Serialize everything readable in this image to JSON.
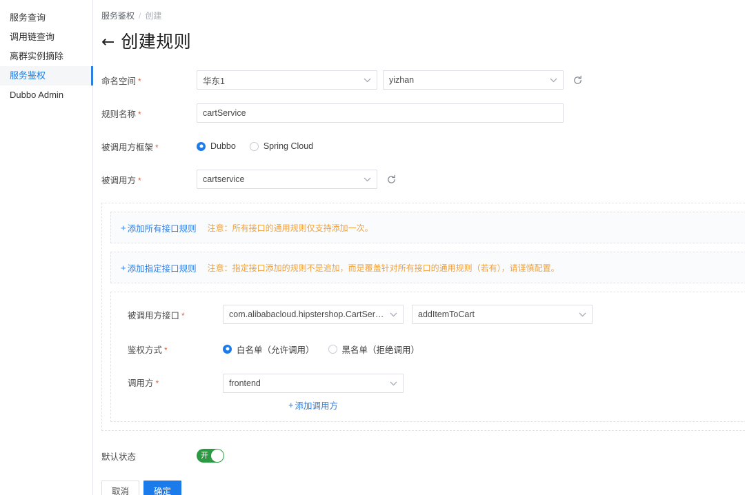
{
  "sidebar": {
    "items": [
      {
        "label": "服务查询",
        "active": false
      },
      {
        "label": "调用链查询",
        "active": false
      },
      {
        "label": "离群实例摘除",
        "active": false
      },
      {
        "label": "服务鉴权",
        "active": true
      },
      {
        "label": "Dubbo Admin",
        "active": false
      }
    ]
  },
  "breadcrumb": {
    "root": "服务鉴权",
    "separator": "/",
    "current": "创建"
  },
  "header": {
    "back_icon": "←",
    "title": "创建规则"
  },
  "form": {
    "namespace": {
      "label": "命名空间",
      "required": "*",
      "region_value": "华东1",
      "namespace_value": "yizhan",
      "refresh_icon": "refresh-icon"
    },
    "rule_name": {
      "label": "规则名称",
      "required": "*",
      "value": "cartService",
      "placeholder": ""
    },
    "framework": {
      "label": "被调用方框架",
      "required": "*",
      "options": [
        {
          "label": "Dubbo",
          "selected": true
        },
        {
          "label": "Spring Cloud",
          "selected": false
        }
      ]
    },
    "callee": {
      "label": "被调用方",
      "required": "*",
      "value": "cartservice",
      "refresh_icon": "refresh-icon"
    }
  },
  "rules": {
    "all_interface": {
      "add_label": "添加所有接口规则",
      "plus": "+",
      "note": "注意：所有接口的通用规则仅支持添加一次。"
    },
    "specified_interface": {
      "add_label": "添加指定接口规则",
      "plus": "+",
      "note": "注意：指定接口添加的规则不是追加，而是覆盖针对所有接口的通用规则（若有），请谨慎配置。"
    },
    "interface_card": {
      "close_icon": "✕",
      "interface": {
        "label": "被调用方接口",
        "required": "*",
        "class_value": "com.alibabacloud.hipstershop.CartServic...",
        "method_value": "addItemToCart"
      },
      "auth_mode": {
        "label": "鉴权方式",
        "required": "*",
        "options": [
          {
            "label": "白名单（允许调用）",
            "selected": true
          },
          {
            "label": "黑名单（拒绝调用）",
            "selected": false
          }
        ]
      },
      "caller": {
        "label": "调用方",
        "required": "*",
        "value": "frontend",
        "add_label": "添加调用方",
        "plus": "+"
      }
    }
  },
  "footer": {
    "default_state": {
      "label": "默认状态",
      "toggle_on": true,
      "toggle_text": "开"
    },
    "cancel_label": "取消",
    "confirm_label": "确定"
  },
  "colors": {
    "accent_blue": "#1b7bea",
    "link_blue": "#2f7fe4",
    "warn_orange": "#f0a13a",
    "toggle_green": "#2c9a42",
    "required_red": "#e8603c"
  }
}
